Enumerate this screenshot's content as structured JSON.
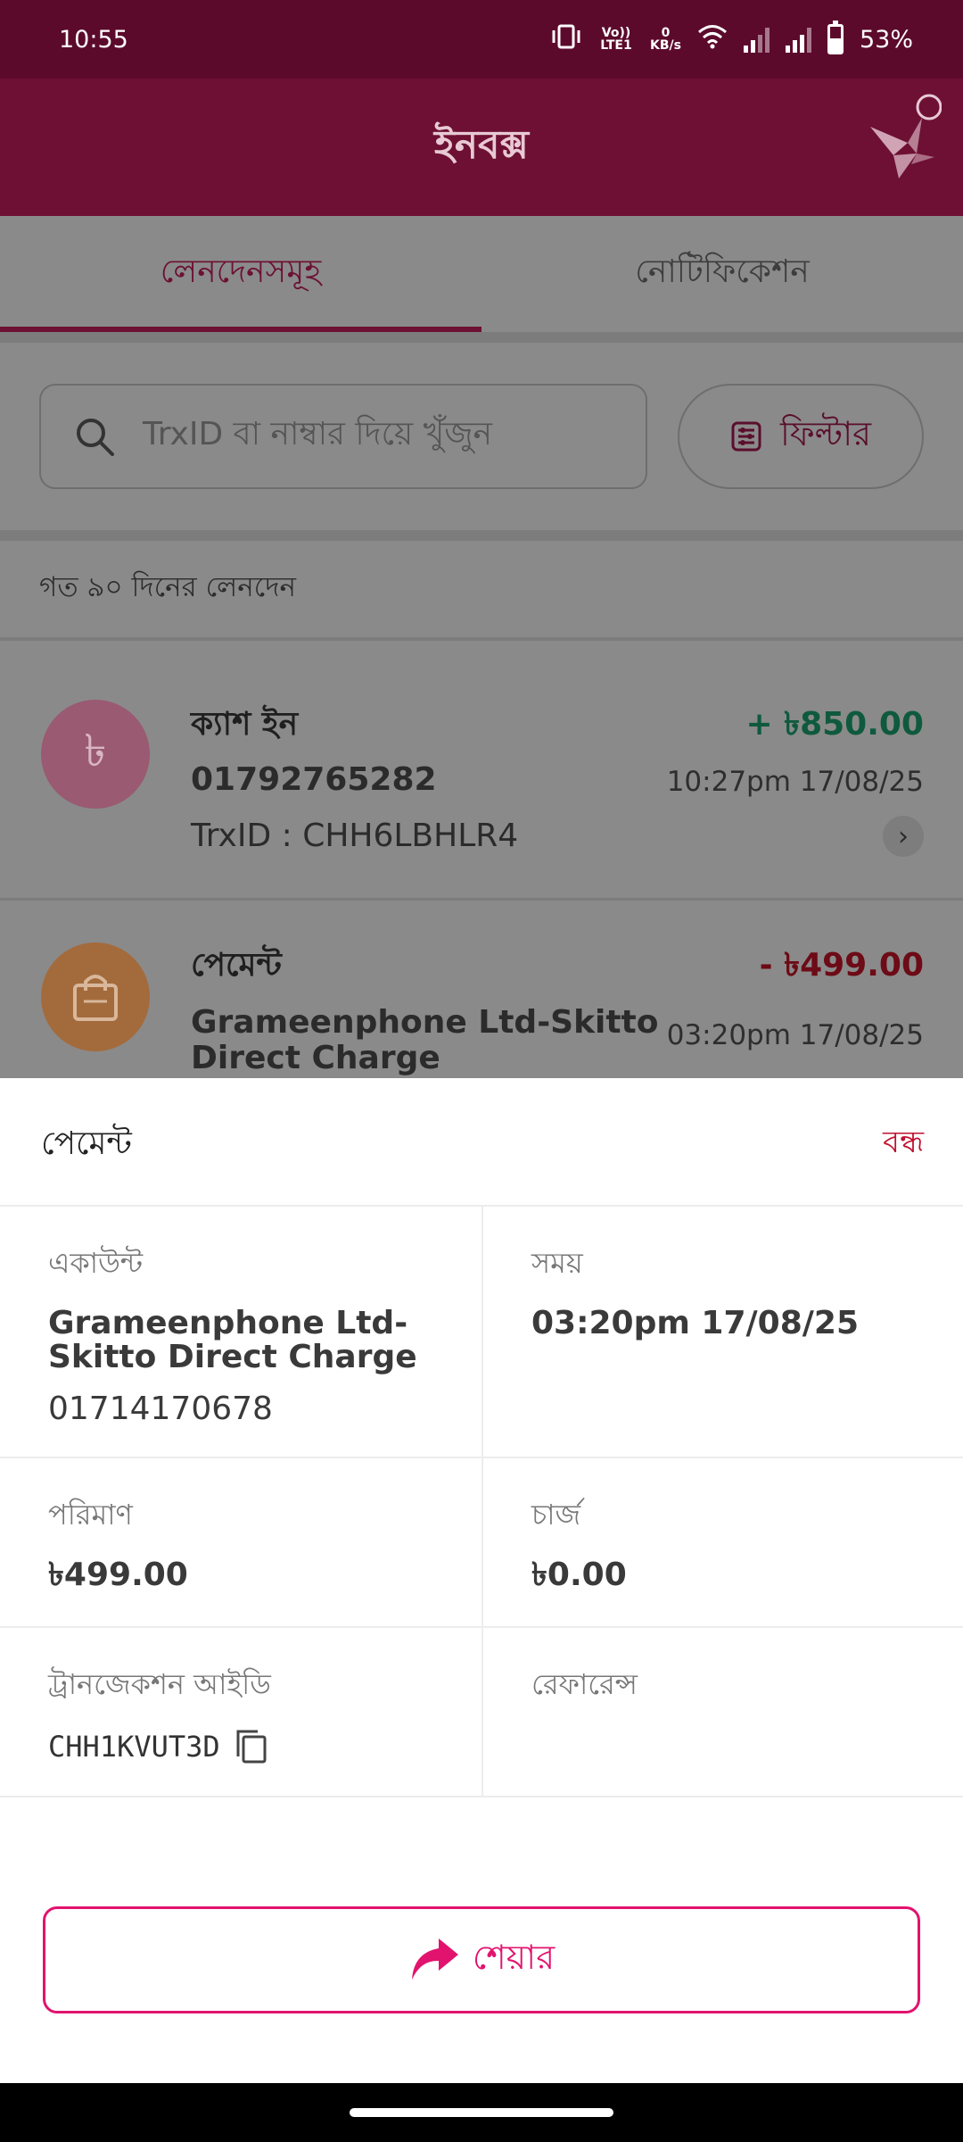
{
  "status_bar": {
    "time": "10:55",
    "volte": "Vo)) LTE1",
    "speed_value": "0",
    "speed_unit": "KB/s",
    "battery": "53%",
    "battery_level": 0.53
  },
  "header": {
    "title": "ইনবক্স"
  },
  "tabs": [
    {
      "label": "লেনদেনসমূহ",
      "active": true
    },
    {
      "label": "নোটিফিকেশন",
      "active": false
    }
  ],
  "search": {
    "placeholder": "TrxID বা নাম্বার দিয়ে খুঁজুন"
  },
  "filter": {
    "label": "ফিল্টার"
  },
  "period_label": "গত ৯০ দিনের লেনদেন",
  "transactions": [
    {
      "type": "ক্যাশ ইন",
      "number": "01792765282",
      "trxid": "TrxID : CHH6LBHLR4",
      "amount": "+ ৳850.00",
      "time": "10:27pm 17/08/25",
      "avatar_symbol": "৳",
      "amount_color": "#0f5a3f"
    },
    {
      "type": "পেমেন্ট",
      "merchant_line1": "Grameenphone Ltd-Skitto",
      "merchant_line2": "Direct Charge",
      "amount": "- ৳499.00",
      "time": "03:20pm 17/08/25",
      "amount_color": "#6d0b16"
    }
  ],
  "sheet": {
    "title": "পেমেন্ট",
    "close": "বন্ধ",
    "account_label": "একাউন্ট",
    "account_name_line1": "Grameenphone Ltd-",
    "account_name_line2": "Skitto Direct Charge",
    "account_number": "01714170678",
    "time_label": "সময়",
    "time_value": "03:20pm 17/08/25",
    "amount_label": "পরিমাণ",
    "amount_value": "৳499.00",
    "charge_label": "চার্জ",
    "charge_value": "৳0.00",
    "trxid_label": "ট্রানজেকশন আইডি",
    "trxid_value": "CHH1KVUT3D",
    "reference_label": "রেফারেন্স",
    "share_label": "শেয়ার"
  },
  "colors": {
    "brand": "#e2136e",
    "header_bg": "#6d1033",
    "status_bg": "#5c0a2c",
    "close_red": "#c0102e"
  }
}
